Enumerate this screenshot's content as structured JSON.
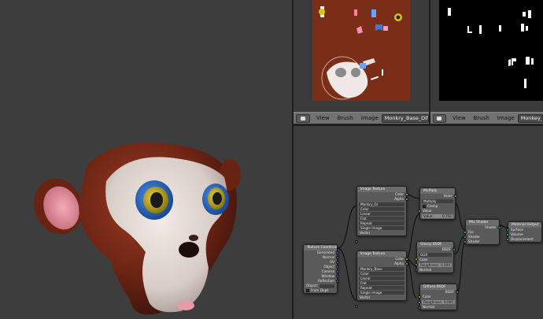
{
  "image_editor_left": {
    "menus": [
      "View",
      "Brush",
      "Image"
    ],
    "image_name": "Monkry_Base_Diffuse"
  },
  "image_editor_right": {
    "menus": [
      "View",
      "Brush",
      "Image"
    ],
    "image_name": "Monkey_Gla"
  },
  "nodes": {
    "image_texture_1": {
      "title": "Image Texture",
      "outputs": [
        "Color",
        "Alpha"
      ],
      "image": "Monkry_Gl",
      "color": "Color",
      "linear": "Linear",
      "flat": "Flat",
      "repeat": "Repeat",
      "single_image": "Single Image",
      "vector": "Vector"
    },
    "image_texture_2": {
      "title": "Image Texture",
      "outputs": [
        "Color",
        "Alpha"
      ],
      "image": "Monkry_Base",
      "color": "Color",
      "linear": "Linear",
      "flat": "Flat",
      "repeat": "Repeat",
      "single_image": "Single Image",
      "vector": "Vector"
    },
    "texture_coordinate": {
      "title": "Texture Coordinate",
      "outputs": [
        "Generated",
        "Normal",
        "UV",
        "Object",
        "Camera",
        "Window",
        "Reflection"
      ],
      "object_label": "Object:",
      "from_dupli": "From Dupli"
    },
    "multiply": {
      "title": "Multiply",
      "output": "Value",
      "mode": "Multiply",
      "clamp": "Clamp",
      "input_value": "Value",
      "value_field": "Value:",
      "value_num": "0.750"
    },
    "glossy": {
      "title": "Glossy BSDF",
      "output": "BSDF",
      "distribution": "GGX",
      "color": "Color",
      "roughness_label": "Roughness:",
      "roughness": "0.200",
      "normal": "Normal"
    },
    "diffuse": {
      "title": "Diffuse BSDF",
      "output": "BSDF",
      "color": "Color",
      "roughness_label": "Roughness:",
      "roughness": "0.000",
      "normal": "Normal"
    },
    "mix_shader": {
      "title": "Mix Shader",
      "output": "Shader",
      "inputs": [
        "Fac",
        "Shader",
        "Shader"
      ]
    },
    "material_output": {
      "title": "Material Output",
      "inputs": [
        "Surface",
        "Volume",
        "Displacement"
      ]
    }
  },
  "colors": {
    "monkey_fur": "#7a2818",
    "monkey_face": "#e4d8d2",
    "eye_iris": "#c9b21e",
    "eye_blue": "#2f6fc4",
    "diffuse_bg": "#7a2e18"
  }
}
